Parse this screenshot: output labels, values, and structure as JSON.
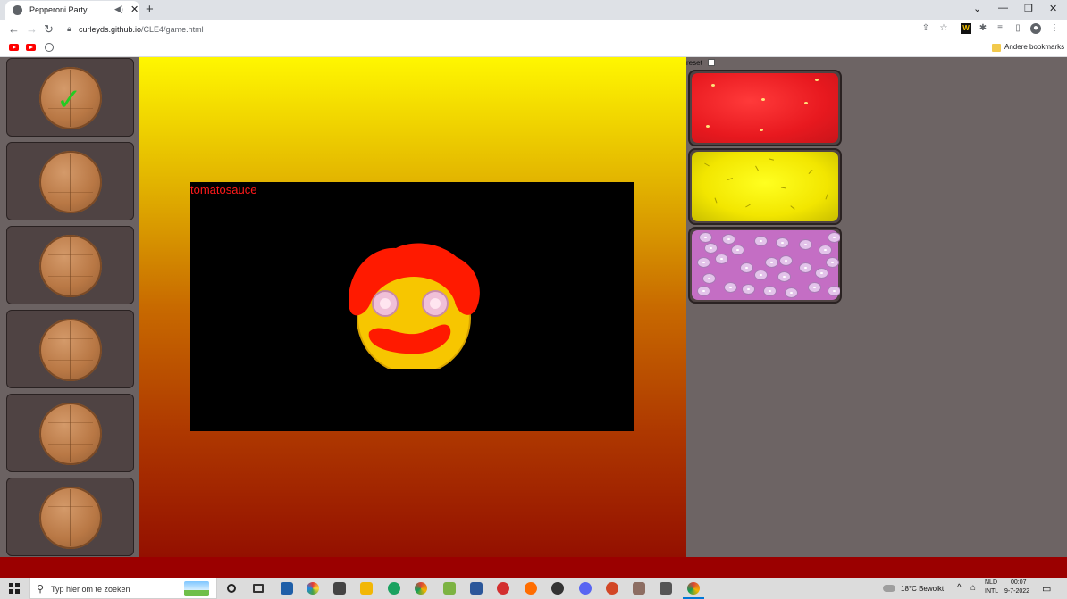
{
  "browser": {
    "tab_title": "Pepperoni Party",
    "tab_close": "✕",
    "new_tab": "+",
    "url_host": "curleyds.github.io",
    "url_path": "/CLE4/game.html",
    "other_bookmarks": "Andere bookmarks",
    "window_controls": [
      "⌄",
      "—",
      "❐",
      "✕"
    ]
  },
  "game": {
    "canvas_label": "tomatosauce",
    "reset_label": "reset",
    "reset_checked": false,
    "order_slots": [
      {
        "completed": true
      },
      {
        "completed": false
      },
      {
        "completed": false
      },
      {
        "completed": false
      },
      {
        "completed": false
      },
      {
        "completed": false
      }
    ],
    "ingredients": [
      "tomatosauce",
      "cheese",
      "onion"
    ],
    "colors": {
      "sauce": "#ff1a1a",
      "cheese": "#ffe000",
      "onion": "#c46ec4",
      "check": "#22cc22"
    }
  },
  "taskbar": {
    "search_placeholder": "Typ hier om te zoeken",
    "weather": "18°C  Bewolkt",
    "lang_top": "NLD",
    "lang_bottom": "INTL",
    "time": "00:07",
    "date": "9-7-2022"
  }
}
